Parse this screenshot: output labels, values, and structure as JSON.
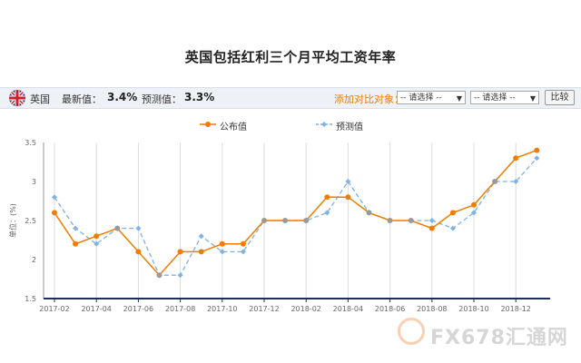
{
  "page": {
    "title": "英国包括红利三个月平均工资年率"
  },
  "toolbar": {
    "country": "英国",
    "latest_label": "最新值：",
    "latest_value": "3.4%",
    "forecast_label": "预测值：",
    "forecast_value": "3.3%",
    "compare_label": "添加对比对象：",
    "select1_value": "-- 请选择 --",
    "select2_value": "-- 请选择 --",
    "compare_button": "比较"
  },
  "watermark": "FX678汇通网",
  "colors": {
    "published": "#f07d00",
    "forecast": "#7fb2e5",
    "axis": "#1f2d5a",
    "grid": "#dddddd",
    "overlap": "#999999"
  },
  "chart_data": {
    "type": "line",
    "ylabel": "单位：(%)",
    "ylim": [
      1.5,
      3.5
    ],
    "yticks": [
      "1.5",
      "2",
      "2.5",
      "3",
      "3.5"
    ],
    "xticks": [
      "2017-02",
      "2017-04",
      "2017-06",
      "2017-08",
      "2017-10",
      "2017-12",
      "2018-02",
      "2018-04",
      "2018-06",
      "2018-08",
      "2018-10",
      "2018-12"
    ],
    "x": [
      "2017-02",
      "2017-03",
      "2017-04",
      "2017-05",
      "2017-06",
      "2017-07",
      "2017-08",
      "2017-09",
      "2017-10",
      "2017-11",
      "2017-12",
      "2018-01",
      "2018-02",
      "2018-03",
      "2018-04",
      "2018-05",
      "2018-06",
      "2018-07",
      "2018-08",
      "2018-09",
      "2018-10",
      "2018-11",
      "2018-12",
      "2019-01"
    ],
    "series": [
      {
        "name": "公布值",
        "style": "solid",
        "color": "#f07d00",
        "values": [
          2.6,
          2.2,
          2.3,
          2.4,
          2.1,
          1.8,
          2.1,
          2.1,
          2.2,
          2.2,
          2.5,
          2.5,
          2.5,
          2.8,
          2.8,
          2.6,
          2.5,
          2.5,
          2.4,
          2.6,
          2.7,
          3.0,
          3.3,
          3.4
        ]
      },
      {
        "name": "预测值",
        "style": "dashed",
        "color": "#7fb2e5",
        "values": [
          2.8,
          2.4,
          2.2,
          2.4,
          2.4,
          1.8,
          1.8,
          2.3,
          2.1,
          2.1,
          2.5,
          2.5,
          2.5,
          2.6,
          3.0,
          2.6,
          2.5,
          2.5,
          2.5,
          2.4,
          2.6,
          3.0,
          3.0,
          3.3
        ]
      }
    ],
    "legend_position": "top-center",
    "grid": "vertical"
  }
}
